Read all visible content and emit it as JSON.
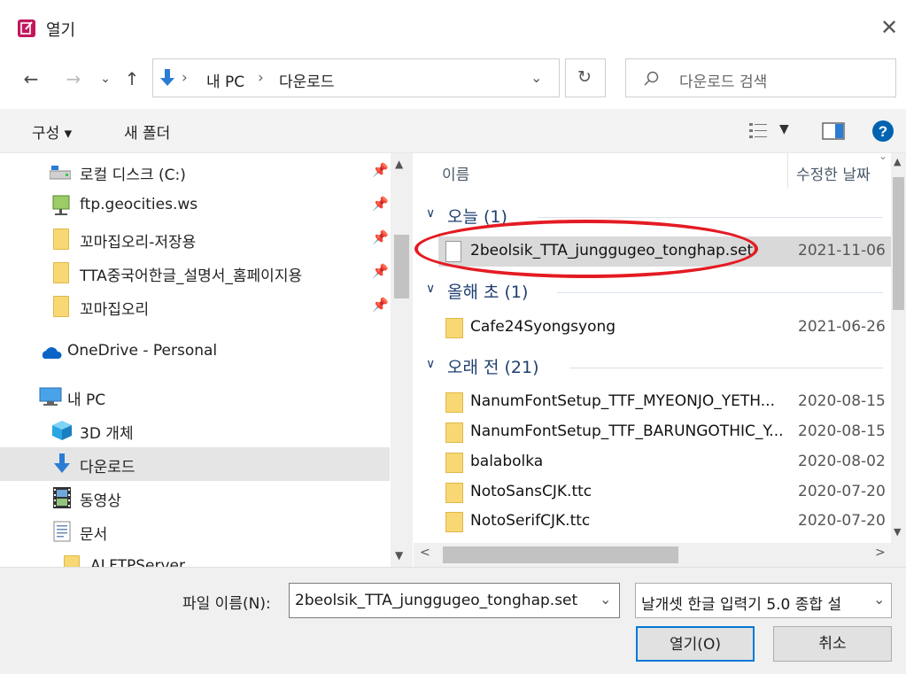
{
  "window": {
    "title": "열기"
  },
  "nav": {
    "back": "←",
    "forward": "→",
    "recent": "⌄",
    "up": "↑"
  },
  "address": {
    "seg1": "내 PC",
    "seg2": "다운로드",
    "sep": "›"
  },
  "search": {
    "placeholder": "다운로드 검색"
  },
  "toolbar": {
    "organize": "구성 ▾",
    "new_folder": "새 폴더"
  },
  "sidebar": {
    "items": [
      {
        "label": "로컬 디스크 (C:)",
        "icon": "drive-icon",
        "pinned": true
      },
      {
        "label": "ftp.geocities.ws",
        "icon": "network-location-icon",
        "pinned": true
      },
      {
        "label": "꼬마집오리-저장용",
        "icon": "folder-icon",
        "pinned": true
      },
      {
        "label": "TTA중국어한글_설명서_홈페이지용",
        "icon": "folder-icon",
        "pinned": true
      },
      {
        "label": "꼬마집오리",
        "icon": "folder-icon",
        "pinned": true
      },
      {
        "label": "OneDrive - Personal",
        "icon": "onedrive-icon",
        "pinned": false
      },
      {
        "label": "내 PC",
        "icon": "pc-icon",
        "pinned": false
      },
      {
        "label": "3D 개체",
        "icon": "3d-objects-icon",
        "pinned": false
      },
      {
        "label": "다운로드",
        "icon": "downloads-icon",
        "pinned": false,
        "selected": true
      },
      {
        "label": "동영상",
        "icon": "videos-icon",
        "pinned": false
      },
      {
        "label": "문서",
        "icon": "documents-icon",
        "pinned": false
      },
      {
        "label": "ALFTPServer",
        "icon": "folder-icon",
        "pinned": false
      }
    ]
  },
  "columns": {
    "name": "이름",
    "date": "수정한 날짜"
  },
  "groups": [
    {
      "label": "오늘 (1)"
    },
    {
      "label": "올해 초 (1)"
    },
    {
      "label": "오래 전 (21)"
    }
  ],
  "files": [
    {
      "name": "2beolsik_TTA_junggugeo_tonghap.set",
      "date": "2021-11-06",
      "type": "file",
      "selected": true
    },
    {
      "name": "Cafe24Syongsyong",
      "date": "2021-06-26",
      "type": "folder"
    },
    {
      "name": "NanumFontSetup_TTF_MYEONJO_YETH...",
      "date": "2020-08-15",
      "type": "folder"
    },
    {
      "name": "NanumFontSetup_TTF_BARUNGOTHIC_Y...",
      "date": "2020-08-15",
      "type": "folder"
    },
    {
      "name": "balabolka",
      "date": "2020-08-02",
      "type": "folder"
    },
    {
      "name": "NotoSansCJK.ttc",
      "date": "2020-07-20",
      "type": "folder"
    },
    {
      "name": "NotoSerifCJK.ttc",
      "date": "2020-07-20",
      "type": "folder"
    }
  ],
  "footer": {
    "filename_label": "파일 이름(N):",
    "filename_value": "2beolsik_TTA_junggugeo_tonghap.set",
    "filetype_value": "날개셋 한글 입력기 5.0 종합 설",
    "open_label": "열기(O)",
    "cancel_label": "취소"
  },
  "colors": {
    "accent": "#0078d7",
    "highlight_ring": "#e41b23",
    "group_header": "#1e3f6f"
  }
}
